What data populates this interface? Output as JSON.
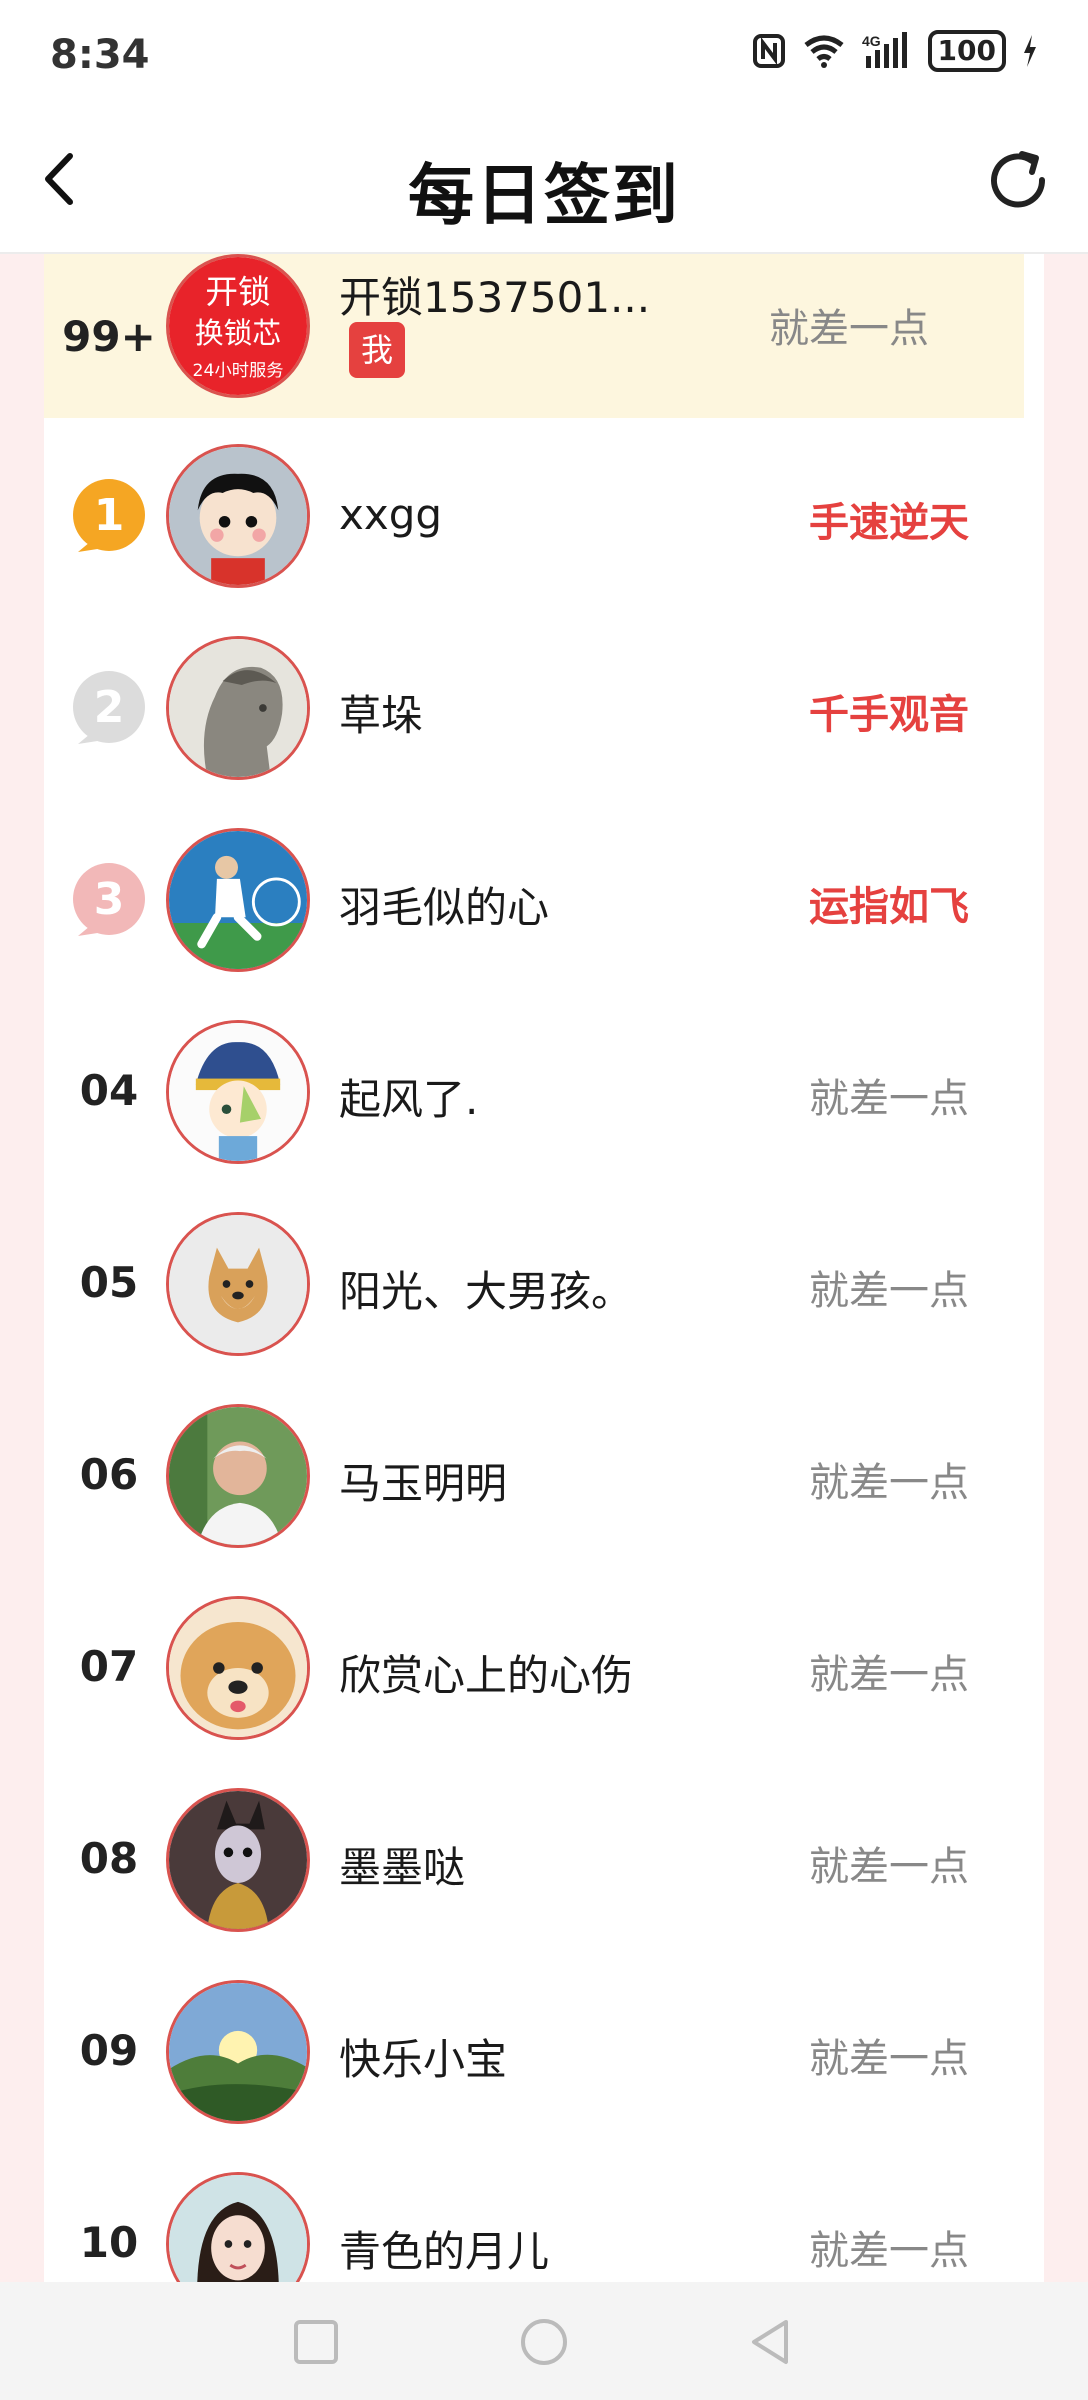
{
  "status_bar": {
    "time": "8:34",
    "battery": "100",
    "network": "4G"
  },
  "header": {
    "title": "每日签到"
  },
  "me": {
    "rank": "99+",
    "name": "开锁1537501...",
    "tag": "我",
    "status": "就差一点",
    "avatar_text_1": "开锁",
    "avatar_text_2": "换锁芯",
    "avatar_text_3": "24小时服务"
  },
  "rows": [
    {
      "rank": "1",
      "name": "xxgg",
      "status": "手速逆天"
    },
    {
      "rank": "2",
      "name": "草垛",
      "status": "千手观音"
    },
    {
      "rank": "3",
      "name": "羽毛似的心",
      "status": "运指如飞"
    },
    {
      "rank": "04",
      "name": "起风了.",
      "status": "就差一点"
    },
    {
      "rank": "05",
      "name": "阳光、大男孩。",
      "status": "就差一点"
    },
    {
      "rank": "06",
      "name": "马玉明明",
      "status": "就差一点"
    },
    {
      "rank": "07",
      "name": "欣赏心上的心伤",
      "status": "就差一点"
    },
    {
      "rank": "08",
      "name": "墨墨哒",
      "status": "就差一点"
    },
    {
      "rank": "09",
      "name": "快乐小宝",
      "status": "就差一点"
    },
    {
      "rank": "10",
      "name": "青色的月儿",
      "status": "就差一点"
    }
  ],
  "colors": {
    "accent": "#e5413f",
    "highlight_row": "#fdf6de",
    "side_bg": "#fdeeee",
    "gold": "#f5a623"
  }
}
